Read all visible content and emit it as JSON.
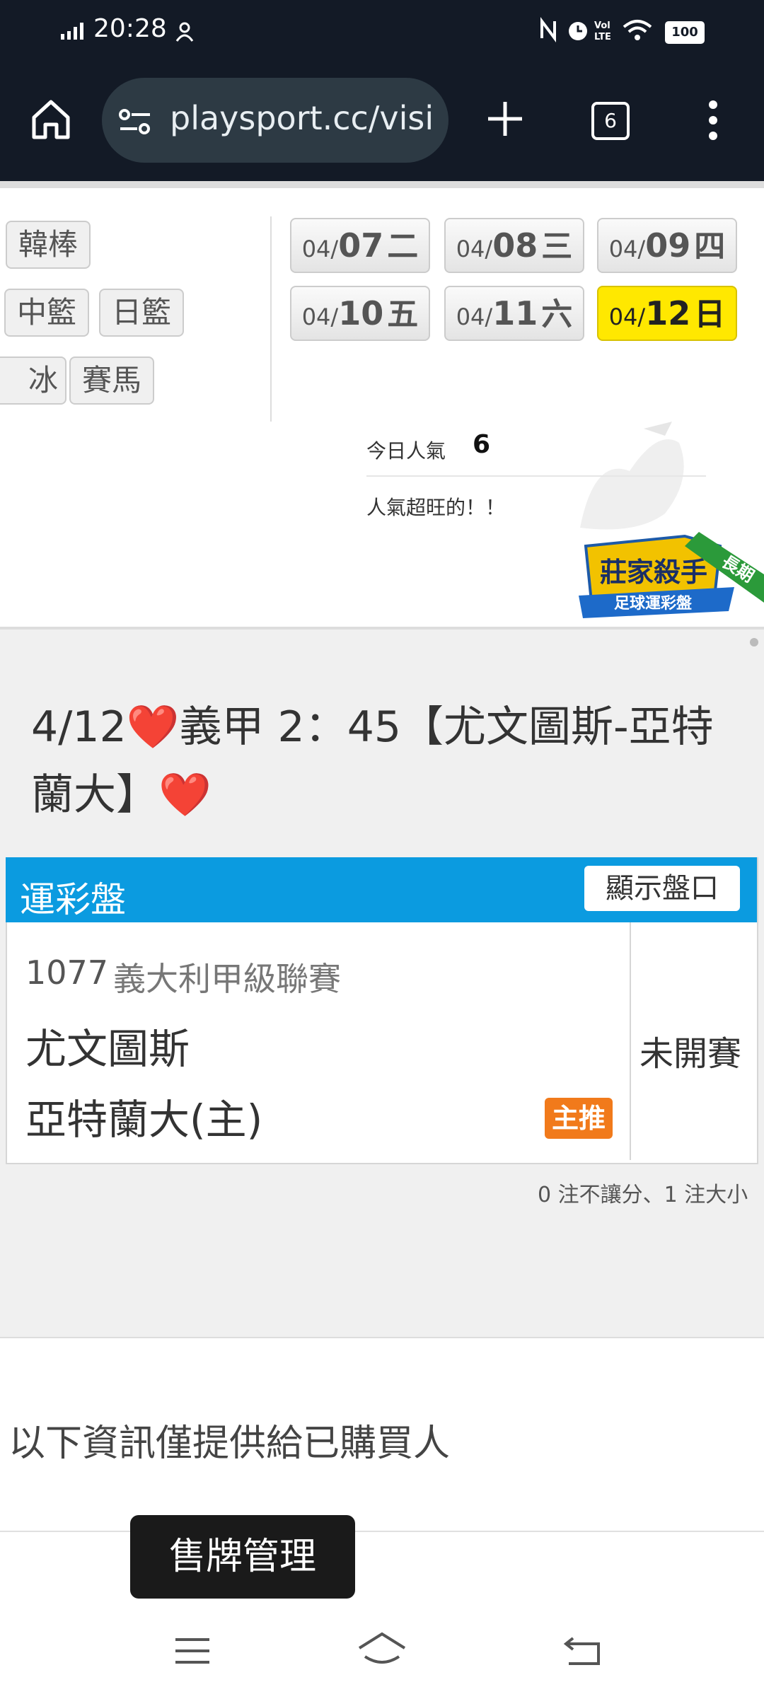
{
  "status_bar": {
    "time": "20:28",
    "battery": "100"
  },
  "browser": {
    "url": "playsport.cc/visit",
    "tab_count": "6"
  },
  "sport_chips": {
    "row1": [
      "韓棒"
    ],
    "row2": [
      "中籃",
      "日籃"
    ],
    "row3": [
      "冰",
      "賽馬"
    ]
  },
  "dates": [
    {
      "md": "04/",
      "day": "07",
      "weekday": "二",
      "selected": false
    },
    {
      "md": "04/",
      "day": "08",
      "weekday": "三",
      "selected": false
    },
    {
      "md": "04/",
      "day": "09",
      "weekday": "四",
      "selected": false
    },
    {
      "md": "04/",
      "day": "10",
      "weekday": "五",
      "selected": false
    },
    {
      "md": "04/",
      "day": "11",
      "weekday": "六",
      "selected": false
    },
    {
      "md": "04/",
      "day": "12",
      "weekday": "日",
      "selected": true
    }
  ],
  "popularity": {
    "label": "今日人氣",
    "value": "6",
    "note": "人氣超旺的！！"
  },
  "badge": {
    "title": "莊家殺手",
    "subtitle": "足球運彩盤",
    "ribbon": "長期"
  },
  "article": {
    "title": "4/12❤️義甲 2：45【尤文圖斯-亞特蘭大】❤️"
  },
  "table": {
    "header": "運彩盤",
    "show_button": "顯示盤口",
    "match_code": "1077",
    "league": "義大利甲級聯賽",
    "team_away": "尤文圖斯",
    "team_home": "亞特蘭大(主)",
    "pick_badge": "主推",
    "status": "未開賽"
  },
  "bet_summary": "0 注不讓分、1 注大小",
  "buyer_note": "以下資訊僅提供給已購買人",
  "sell_button": "售牌管理",
  "colors": {
    "header_blue": "#0b9be0",
    "selected_yellow": "#ffe800",
    "pick_orange": "#f17a1b",
    "topbar": "#131a26"
  }
}
